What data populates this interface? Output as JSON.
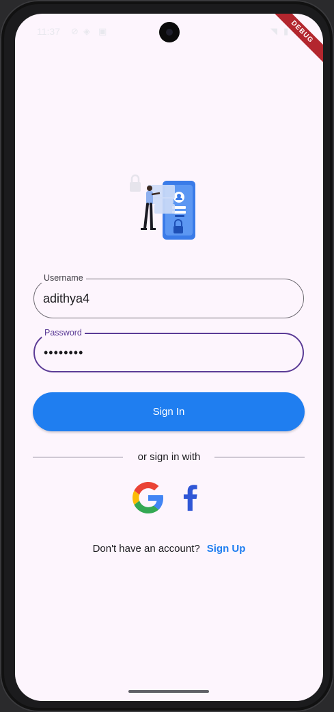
{
  "status_bar": {
    "time": "11:37",
    "debug_badge": "DEBUG"
  },
  "login": {
    "username": {
      "label": "Username",
      "value": "adithya4"
    },
    "password": {
      "label": "Password",
      "value": "••••••••"
    },
    "sign_in_label": "Sign In",
    "divider_text": "or sign in with",
    "social": [
      {
        "icon": "google-icon"
      },
      {
        "icon": "facebook-icon"
      }
    ],
    "signup_prompt": "Don't have an account?",
    "signup_link": "Sign Up"
  },
  "colors": {
    "background": "#fdf5fd",
    "primary": "#1f7ef0",
    "focused_border": "#5b3b96",
    "debug_ribbon": "#b3262e"
  }
}
